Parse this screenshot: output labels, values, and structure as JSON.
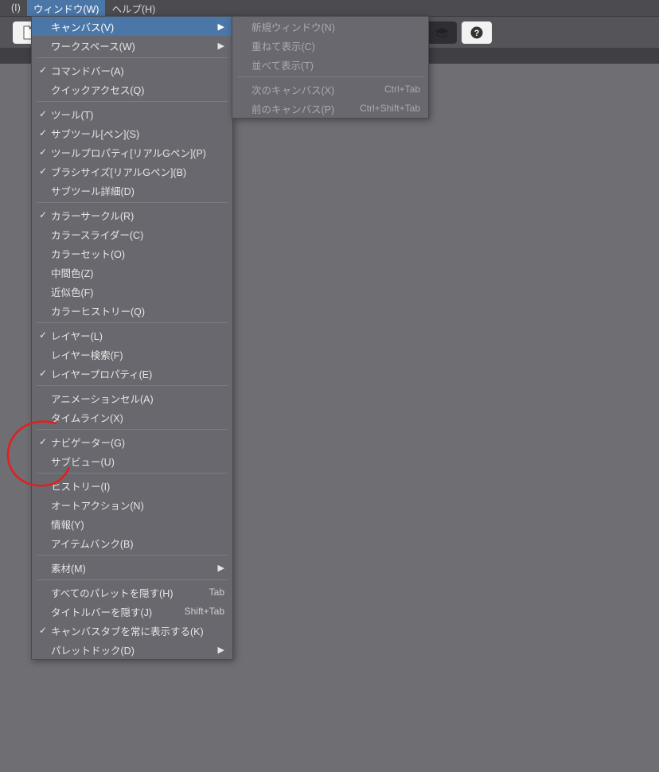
{
  "menubar": {
    "items": [
      {
        "label": "(I)"
      },
      {
        "label": "ウィンドウ(W)"
      },
      {
        "label": "ヘルプ(H)"
      }
    ],
    "active_index": 1
  },
  "window_menu": [
    [
      {
        "label": "キャンバス(V)",
        "checked": false,
        "arrow": true,
        "highlight": true
      },
      {
        "label": "ワークスペース(W)",
        "checked": false,
        "arrow": true
      }
    ],
    [
      {
        "label": "コマンドバー(A)",
        "checked": true
      },
      {
        "label": "クイックアクセス(Q)",
        "checked": false
      }
    ],
    [
      {
        "label": "ツール(T)",
        "checked": true
      },
      {
        "label": "サブツール[ペン](S)",
        "checked": true
      },
      {
        "label": "ツールプロパティ[リアルGペン](P)",
        "checked": true
      },
      {
        "label": "ブラシサイズ[リアルGペン](B)",
        "checked": true
      },
      {
        "label": "サブツール詳細(D)",
        "checked": false
      }
    ],
    [
      {
        "label": "カラーサークル(R)",
        "checked": true
      },
      {
        "label": "カラースライダー(C)",
        "checked": false
      },
      {
        "label": "カラーセット(O)",
        "checked": false
      },
      {
        "label": "中間色(Z)",
        "checked": false
      },
      {
        "label": "近似色(F)",
        "checked": false
      },
      {
        "label": "カラーヒストリー(Q)",
        "checked": false
      }
    ],
    [
      {
        "label": "レイヤー(L)",
        "checked": true
      },
      {
        "label": "レイヤー検索(F)",
        "checked": false
      },
      {
        "label": "レイヤープロパティ(E)",
        "checked": true
      }
    ],
    [
      {
        "label": "アニメーションセル(A)",
        "checked": false
      },
      {
        "label": "タイムライン(X)",
        "checked": false
      }
    ],
    [
      {
        "label": "ナビゲーター(G)",
        "checked": true
      },
      {
        "label": "サブビュー(U)",
        "checked": false
      }
    ],
    [
      {
        "label": "ヒストリー(I)",
        "checked": false
      },
      {
        "label": "オートアクション(N)",
        "checked": false
      },
      {
        "label": "情報(Y)",
        "checked": false
      },
      {
        "label": "アイテムバンク(B)",
        "checked": false
      }
    ],
    [
      {
        "label": "素材(M)",
        "checked": false,
        "arrow": true
      }
    ],
    [
      {
        "label": "すべてのパレットを隠す(H)",
        "checked": false,
        "shortcut": "Tab"
      },
      {
        "label": "タイトルバーを隠す(J)",
        "checked": false,
        "shortcut": "Shift+Tab"
      },
      {
        "label": "キャンバスタブを常に表示する(K)",
        "checked": true
      },
      {
        "label": "パレットドック(D)",
        "checked": false,
        "arrow": true
      }
    ]
  ],
  "canvas_submenu": [
    [
      {
        "label": "新規ウィンドウ(N)",
        "disabled": true
      },
      {
        "label": "重ねて表示(C)",
        "disabled": true
      },
      {
        "label": "並べて表示(T)",
        "disabled": true
      }
    ],
    [
      {
        "label": "次のキャンバス(X)",
        "shortcut": "Ctrl+Tab",
        "disabled": true
      },
      {
        "label": "前のキャンバス(P)",
        "shortcut": "Ctrl+Shift+Tab",
        "disabled": true
      }
    ]
  ],
  "toolbar_icons": {
    "first": "paper-icon",
    "grad": "graduation-cap-icon",
    "help": "help-icon"
  }
}
